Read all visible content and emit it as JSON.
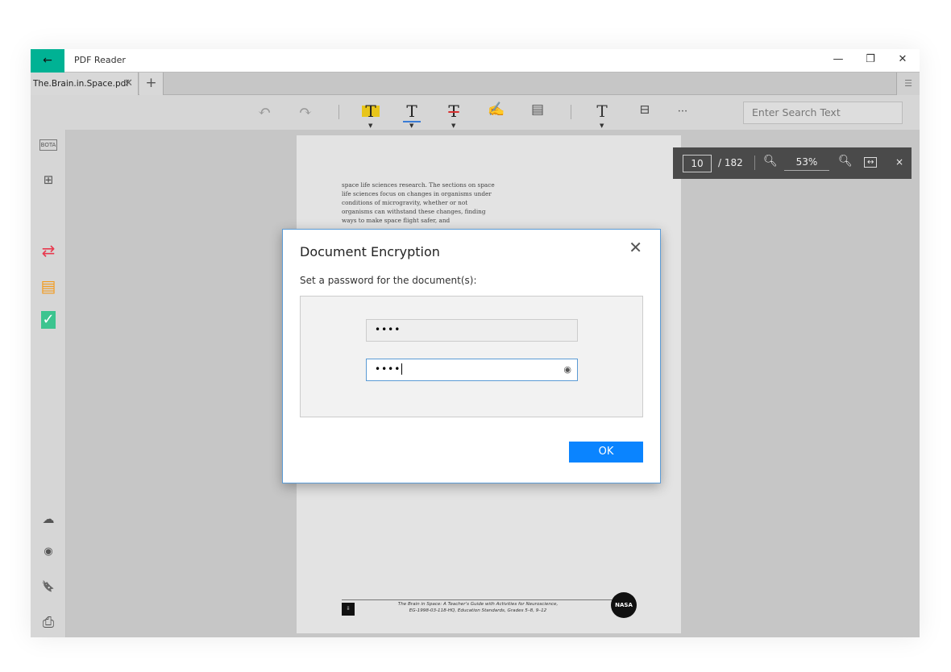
{
  "window": {
    "title": "PDF Reader",
    "back_icon": "←",
    "minimize": "—",
    "restore": "❐",
    "close": "✕"
  },
  "tabs": [
    {
      "label": "The.Brain.in.Space.pdf",
      "close": "✕"
    }
  ],
  "add_tab": "+",
  "toolbar": {
    "undo": "↶",
    "redo": "↷",
    "highlight": "T",
    "underline": "T",
    "strikethrough": "T",
    "signature": "✍",
    "note": "▤",
    "text": "T",
    "stamp": "⊟",
    "more": "···",
    "search_placeholder": "Enter Search Text",
    "highlight_color": "#e8c51a",
    "underline_color": "#3a7bd5",
    "strike_color": "#d93030"
  },
  "sidebar": {
    "bota": "BOTA",
    "thumbnails": "⊞",
    "convert": "⇄",
    "fax": "▤",
    "checklist": "✓",
    "cloud": "☁",
    "view": "◉",
    "bookmark": "🔖",
    "print": "⎙"
  },
  "page": {
    "text": "space life sciences research. The sections on space life sciences focus on changes in organisms under conditions of microgravity, whether or not organisms can withstand these changes, finding ways to make space flight safer, and",
    "page_num": "ii",
    "footer_line1": "The Brain in Space: A Teacher's Guide with Activities for Neuroscience,",
    "footer_line2": "EG-1998-03-118-HQ, Education Standards, Grades 5–8, 9–12",
    "logo": "NASA"
  },
  "zoombar": {
    "current_page": "10",
    "total": "/ 182",
    "zoom": "53%",
    "zoom_out": "−",
    "zoom_in": "+",
    "fit": "↔",
    "close": "×"
  },
  "dialog": {
    "title": "Document Encryption",
    "close": "✕",
    "subtitle": "Set a password for the document(s):",
    "password": "••••",
    "confirm": "••••",
    "ok": "OK"
  }
}
